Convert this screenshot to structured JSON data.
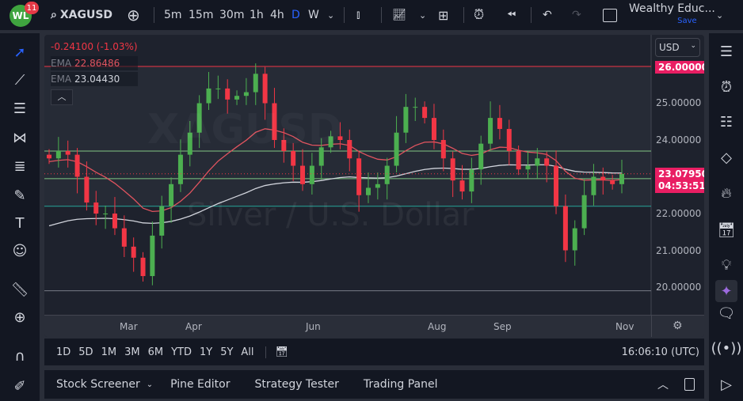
{
  "topbar": {
    "notification_count": "11",
    "logo_text": "WL",
    "symbol": "XAGUSD",
    "intervals": [
      "5m",
      "15m",
      "30m",
      "1h",
      "4h",
      "D",
      "W"
    ],
    "active_interval": "D",
    "layout_name": "Wealthy Educ...",
    "save_label": "Save"
  },
  "legend": {
    "change": "-0.24100 (-1.03%)",
    "ema1_label": "EMA",
    "ema1_value": "22.86486",
    "ema2_label": "EMA",
    "ema2_value": "23.04430"
  },
  "watermark": {
    "symbol": "XAGUSD",
    "description": "Silver / U.S. Dollar"
  },
  "price_axis": {
    "currency": "USD",
    "ticks": [
      "25.00000",
      "24.00000",
      "22.00000",
      "21.00000",
      "20.00000"
    ],
    "level_tag": "26.00000",
    "last_price": "23.07950",
    "countdown": "04:53:51"
  },
  "time_axis": {
    "labels": [
      "Mar",
      "Apr",
      "Jun",
      "Aug",
      "Sep",
      "Nov"
    ]
  },
  "range_bar": {
    "ranges": [
      "1D",
      "5D",
      "1M",
      "3M",
      "6M",
      "YTD",
      "1Y",
      "5Y",
      "All"
    ],
    "clock": "16:06:10 (UTC)"
  },
  "bottom_panel": {
    "tabs": [
      "Stock Screener",
      "Pine Editor",
      "Strategy Tester",
      "Trading Panel"
    ]
  },
  "colors": {
    "up": "#26a69a",
    "up_candle": "#4caf50",
    "down": "#f23645",
    "ema_fast": "#e0545f",
    "ema_slow": "#d1d4dc",
    "accent": "#2962ff",
    "level_tag": "#e91e63"
  },
  "chart_data": {
    "type": "candlestick",
    "ylim": [
      19.5,
      26.5
    ],
    "closes": [
      23.5,
      23.7,
      23.6,
      23.0,
      22.3,
      22.0,
      22.0,
      21.6,
      21.1,
      20.8,
      20.3,
      21.4,
      22.2,
      22.8,
      23.6,
      24.2,
      25.0,
      25.4,
      25.4,
      25.1,
      25.2,
      25.3,
      25.8,
      25.0,
      24.0,
      23.7,
      23.3,
      22.8,
      23.3,
      23.8,
      24.1,
      24.0,
      23.5,
      22.5,
      22.7,
      22.8,
      23.3,
      24.2,
      24.9,
      24.9,
      24.6,
      24.0,
      23.5,
      22.9,
      22.6,
      23.2,
      23.9,
      24.6,
      24.3,
      23.7,
      23.2,
      23.3,
      23.5,
      23.3,
      22.2,
      21.0,
      21.6,
      22.5,
      23.0,
      22.9,
      22.8,
      23.0795
    ],
    "horizontal_levels": [
      {
        "price": 26.0,
        "color": "#f23645"
      },
      {
        "price": 23.7,
        "color": "#81c784"
      },
      {
        "price": 22.95,
        "color": "#81c784"
      },
      {
        "price": 22.2,
        "color": "#26a69a"
      },
      {
        "price": 19.9,
        "color": "#787b86"
      }
    ]
  }
}
